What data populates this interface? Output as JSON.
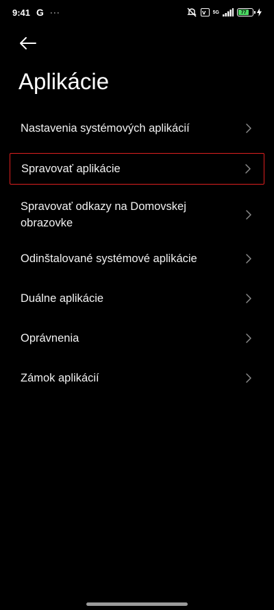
{
  "status_bar": {
    "time": "9:41",
    "g_badge": "G",
    "more_dots": "···",
    "vo_badge": "Vo\nWiFi",
    "net_badge": "5G",
    "battery_level": "77",
    "battery_fraction": 0.77
  },
  "header": {
    "title": "Aplikácie"
  },
  "menu": {
    "items": [
      {
        "label": "Nastavenia systémových aplikácií"
      },
      {
        "label": "Spravovať aplikácie"
      },
      {
        "label": "Spravovať odkazy na Domovskej obrazovke"
      },
      {
        "label": "Odinštalované systémové aplikácie"
      },
      {
        "label": "Duálne aplikácie"
      },
      {
        "label": "Oprávnenia"
      },
      {
        "label": "Zámok aplikácií"
      }
    ],
    "highlighted_index": 1
  },
  "colors": {
    "background": "#000000",
    "text": "#f2f2f2",
    "chevron": "#8a8a8a",
    "highlight_border": "#e02020",
    "battery": "#4cd964"
  }
}
